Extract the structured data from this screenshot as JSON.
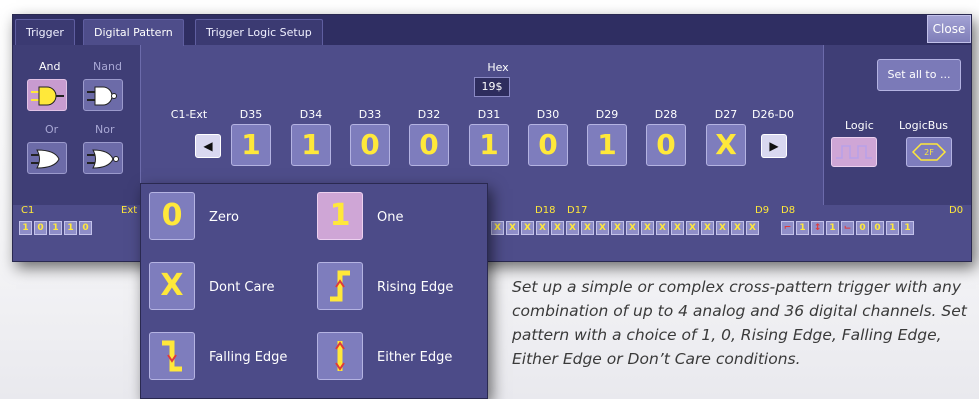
{
  "tabs": [
    {
      "label": "Trigger",
      "active": false
    },
    {
      "label": "Digital Pattern",
      "active": true
    },
    {
      "label": "Trigger Logic Setup",
      "active": false
    }
  ],
  "close_label": "Close",
  "gates": {
    "and": "And",
    "nand": "Nand",
    "or": "Or",
    "nor": "Nor",
    "selected": "And"
  },
  "hex": {
    "label": "Hex",
    "value": "19$"
  },
  "channels": {
    "c1_ext": "C1-Ext",
    "d26_d0": "D26-D0",
    "items": [
      {
        "label": "D35",
        "value": "1"
      },
      {
        "label": "D34",
        "value": "1"
      },
      {
        "label": "D33",
        "value": "0"
      },
      {
        "label": "D32",
        "value": "0"
      },
      {
        "label": "D31",
        "value": "1"
      },
      {
        "label": "D30",
        "value": "0"
      },
      {
        "label": "D29",
        "value": "1"
      },
      {
        "label": "D28",
        "value": "0"
      },
      {
        "label": "D27",
        "value": "X"
      }
    ]
  },
  "set_all_label": "Set all to ...",
  "logic_labels": {
    "logic": "Logic",
    "logicbus": "LogicBus",
    "bus_value": "2F"
  },
  "strip": {
    "c1": "C1",
    "ext": "Ext",
    "d18": "D18",
    "d17": "D17",
    "d9": "D9",
    "d8": "D8",
    "d0": "D0",
    "left_bits": [
      "1",
      "0",
      "1",
      "1",
      "0"
    ],
    "right_bits": [
      "1",
      "1",
      "0",
      "0",
      "1",
      "1"
    ]
  },
  "popup": {
    "zero_symbol": "0",
    "zero": "Zero",
    "one_symbol": "1",
    "one": "One",
    "dontcare_symbol": "X",
    "dontcare": "Dont Care",
    "rising": "Rising Edge",
    "falling": "Falling Edge",
    "either": "Either Edge"
  },
  "caption": "Set up a simple or complex cross-pattern trigger with any combination of up to 4 analog and 36 digital channels. Set pattern with a choice of 1, 0, Rising Edge, Falling Edge, Either Edge or Don’t Care conditions.",
  "colors": {
    "panel": "#4e4d8a",
    "accent_yellow": "#ffe83a",
    "selected_pink": "#c89bd0"
  }
}
